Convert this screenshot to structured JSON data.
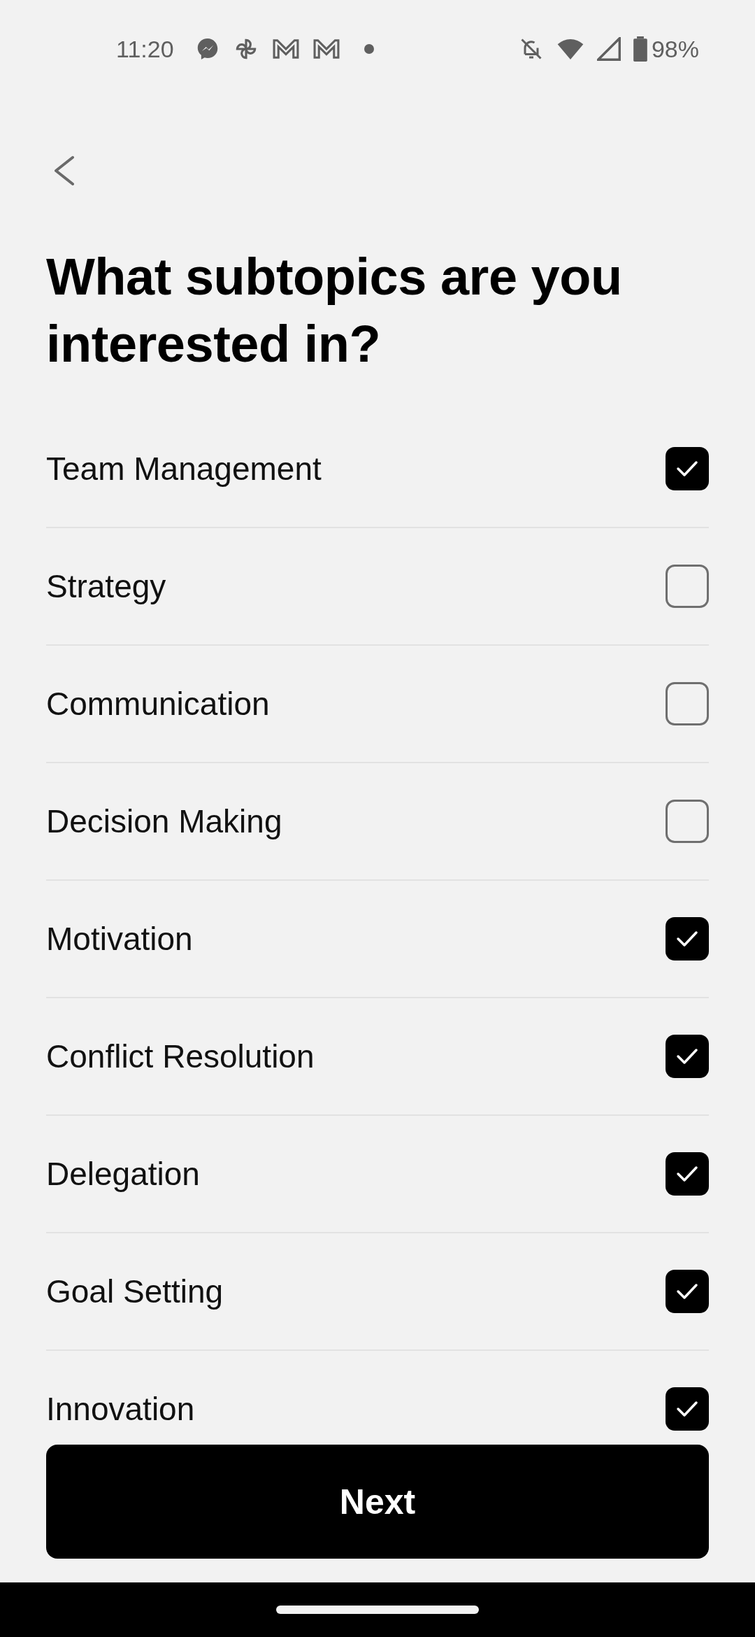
{
  "status_bar": {
    "time": "11:20",
    "battery": "98%"
  },
  "title": "What subtopics are you interested in?",
  "options": [
    {
      "label": "Team Management",
      "checked": true
    },
    {
      "label": "Strategy",
      "checked": false
    },
    {
      "label": "Communication",
      "checked": false
    },
    {
      "label": "Decision Making",
      "checked": false
    },
    {
      "label": "Motivation",
      "checked": true
    },
    {
      "label": "Conflict Resolution",
      "checked": true
    },
    {
      "label": "Delegation",
      "checked": true
    },
    {
      "label": "Goal Setting",
      "checked": true
    },
    {
      "label": "Innovation",
      "checked": true
    }
  ],
  "next_button": "Next"
}
